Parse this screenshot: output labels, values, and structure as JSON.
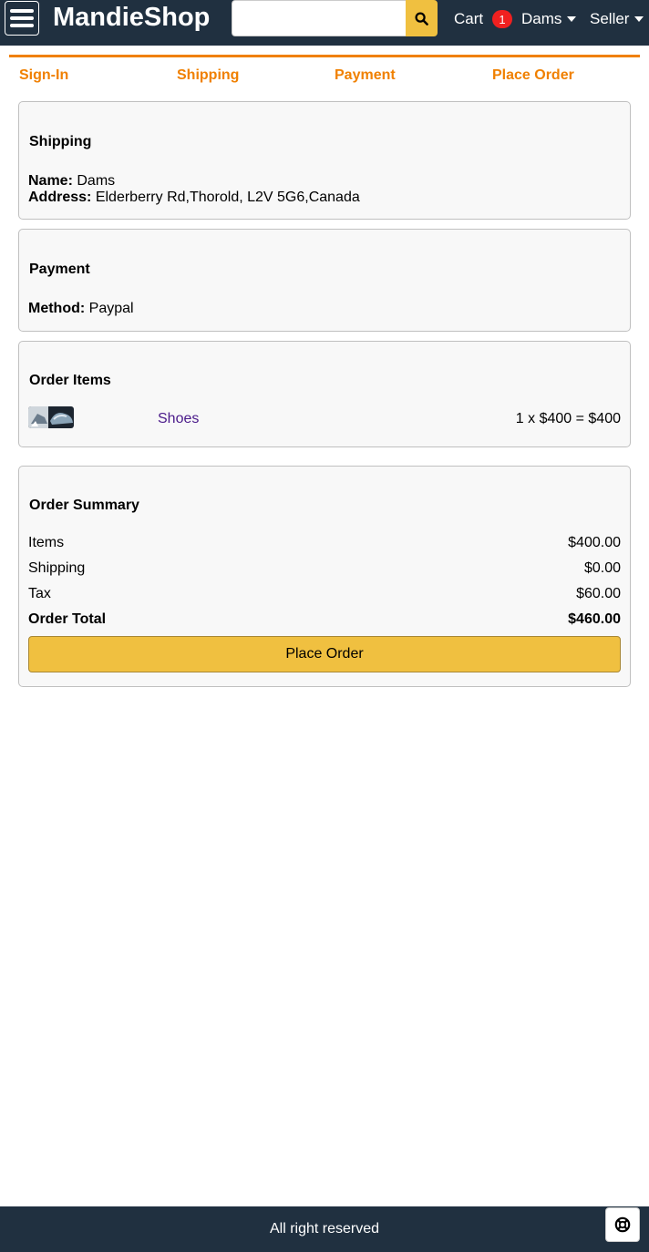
{
  "header": {
    "brand": "MandieShop",
    "search": {
      "value": "",
      "placeholder": ""
    },
    "cart_label": "Cart",
    "cart_count": "1",
    "user_label": "Dams",
    "seller_label": "Seller"
  },
  "steps": [
    "Sign-In",
    "Shipping",
    "Payment",
    "Place Order"
  ],
  "shipping": {
    "title": "Shipping",
    "name_label": "Name:",
    "name_value": "Dams",
    "address_label": "Address:",
    "address_value": "Elderberry Rd,Thorold, L2V 5G6,Canada"
  },
  "payment": {
    "title": "Payment",
    "method_label": "Method:",
    "method_value": "Paypal"
  },
  "order_items": {
    "title": "Order Items",
    "items": [
      {
        "name": "Shoes",
        "price_line": "1 x $400 = $400"
      }
    ]
  },
  "summary": {
    "title": "Order Summary",
    "rows": [
      {
        "label": "Items",
        "value": "$400.00"
      },
      {
        "label": "Shipping",
        "value": "$0.00"
      },
      {
        "label": "Tax",
        "value": "$60.00"
      },
      {
        "label": "Order Total",
        "value": "$460.00"
      }
    ],
    "button_label": "Place Order"
  },
  "footer": {
    "text": "All right reserved"
  },
  "colors": {
    "navbar": "#203040",
    "accent": "#f0c040",
    "step": "#f08000",
    "link": "#4a1a8a"
  }
}
